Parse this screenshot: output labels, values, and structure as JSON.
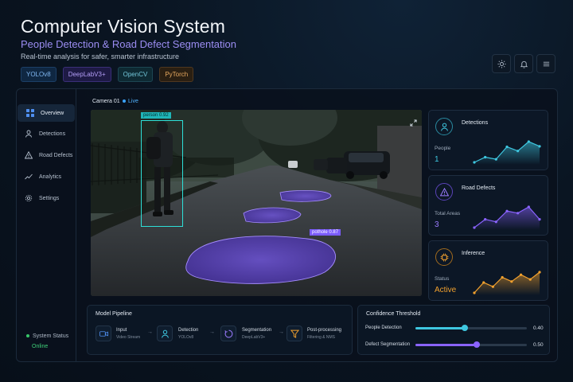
{
  "header": {
    "title": "Computer Vision System",
    "subtitle": "People Detection & Road Defect Segmentation",
    "tagline": "Real-time analysis for safer, smarter infrastructure",
    "chips": [
      "YOLOv8",
      "DeepLabV3+",
      "OpenCV",
      "PyTorch"
    ],
    "toolbar_icons": [
      "sun-icon",
      "bell-icon",
      "menu-icon"
    ]
  },
  "sidebar": {
    "items": [
      {
        "label": "Overview",
        "icon": "grid-icon",
        "active": true
      },
      {
        "label": "Detections",
        "icon": "person-icon",
        "active": false
      },
      {
        "label": "Road Defects",
        "icon": "warning-icon",
        "active": false
      },
      {
        "label": "Analytics",
        "icon": "chart-icon",
        "active": false
      },
      {
        "label": "Settings",
        "icon": "gear-icon",
        "active": false
      }
    ],
    "status_label": "System Status",
    "status_value": "Online"
  },
  "camera": {
    "name": "Camera 01",
    "live": "Live",
    "detections": [
      {
        "label": "person 0.92"
      },
      {
        "label": "pothole 0.87"
      }
    ]
  },
  "cards": [
    {
      "title": "Detections",
      "key": "People",
      "value": "1",
      "color": "#3ec7e0",
      "series": [
        2,
        3,
        2.6,
        5,
        4.2,
        6,
        5.1
      ]
    },
    {
      "title": "Road Defects",
      "key": "Total Areas",
      "value": "3",
      "color": "#8a63ff",
      "series": [
        1,
        3,
        2.4,
        5,
        4.5,
        6,
        3
      ]
    },
    {
      "title": "Inference",
      "key": "Status",
      "value": "Active",
      "color": "#f2a12e",
      "series": [
        1,
        3,
        2.2,
        4,
        3.2,
        4.5,
        3.6,
        5
      ]
    }
  ],
  "pipeline": {
    "title": "Model Pipeline",
    "steps": [
      {
        "title": "Input",
        "sub": "Video Stream",
        "icon": "video-icon"
      },
      {
        "title": "Detection",
        "sub": "YOLOv8",
        "icon": "person-icon"
      },
      {
        "title": "Segmentation",
        "sub": "DeepLabV3+",
        "icon": "segment-icon"
      },
      {
        "title": "Post-processing",
        "sub": "Filtering & NMS",
        "icon": "filter-icon"
      }
    ]
  },
  "thresholds": {
    "title": "Confidence Threshold",
    "items": [
      {
        "label": "People Detection",
        "value": "0.40",
        "level": 0.4,
        "color": "#3ec7e0"
      },
      {
        "label": "Defect Segmentation",
        "value": "0.50",
        "level": 0.5,
        "color": "#8a63ff"
      }
    ]
  }
}
